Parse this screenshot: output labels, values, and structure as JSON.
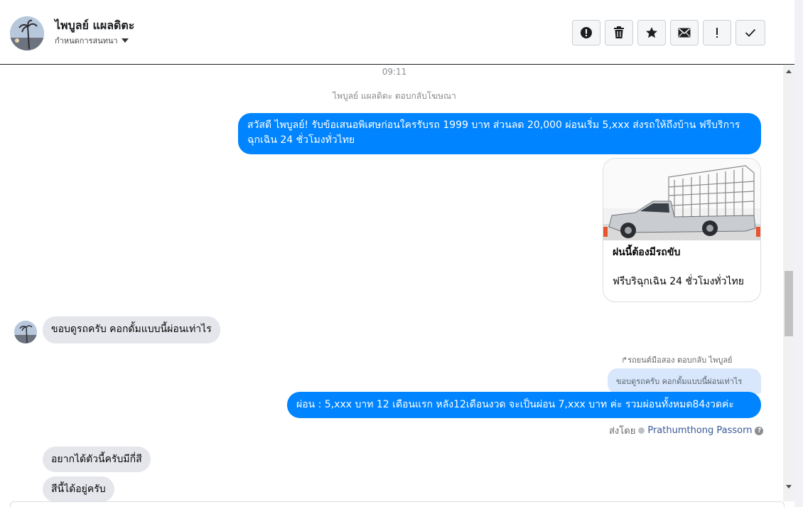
{
  "header": {
    "contact_name": "ไพบูลย์ แผลดิตะ",
    "assign_label": "กำหนดการสนทนา",
    "toolbar": [
      {
        "name": "report-icon-button",
        "icon": "exclamation-circle-icon"
      },
      {
        "name": "delete-button",
        "icon": "trash-icon"
      },
      {
        "name": "star-button",
        "icon": "star-icon"
      },
      {
        "name": "mark-unread-button",
        "icon": "envelope-icon"
      },
      {
        "name": "spam-button",
        "icon": "exclamation-icon"
      },
      {
        "name": "done-button",
        "icon": "check-icon"
      }
    ]
  },
  "conversation": {
    "timestamp": "09:11",
    "ad_reply_note": "ไพบูลย์ แผลดิตะ ตอบกลับโฆษณา",
    "outgoing_1": "สวัสดี ไพบูลย์! รับข้อเสนอพิเศษก่อนใครรับรถ 1999 บาท ส่วนลด 20,000  ผ่อนเริ่ม 5,xxx ส่งรถให้ถึงบ้าน ฟรีบริการฉุกเฉิน 24 ชั่วโมงทั่วไทย",
    "card": {
      "title": "ฝนนี้ต้องมีรถขับ",
      "description": "ฟรีบริฉุกเฉิน 24 ชั่วโมงทั่วไทย"
    },
    "incoming_1": "ขอบดูรถครับ คอกดั้มแบบนี้ผ่อนเท่าไร",
    "reply_label": "รถยนต์มือสอง ตอบกลับ ไพบูลย์",
    "quoted_text": "ขอบดูรถครับ คอกดั้มแบบนี้ผ่อนเท่าไร",
    "outgoing_2": "ผ่อน : 5,xxx บาท 12 เดือนแรก หลัง12เดือนงวด จะเป็นผ่อน 7,xxx บาท ค่ะ รวมผ่อนทั้งหมด84งวดค่ะ",
    "sent_by_label": "ส่งโดย",
    "sent_by_agent": "Prathumthong Passorn",
    "incoming_2": "อยากได้ตัวนี้ครับมีกี่สี",
    "incoming_3": "สีนี้ได้อยู่ครับ"
  },
  "colors": {
    "outgoing_bubble": "#0084ff",
    "incoming_bubble": "#e4e6eb",
    "quoted_bubble": "#d8e7fb"
  }
}
